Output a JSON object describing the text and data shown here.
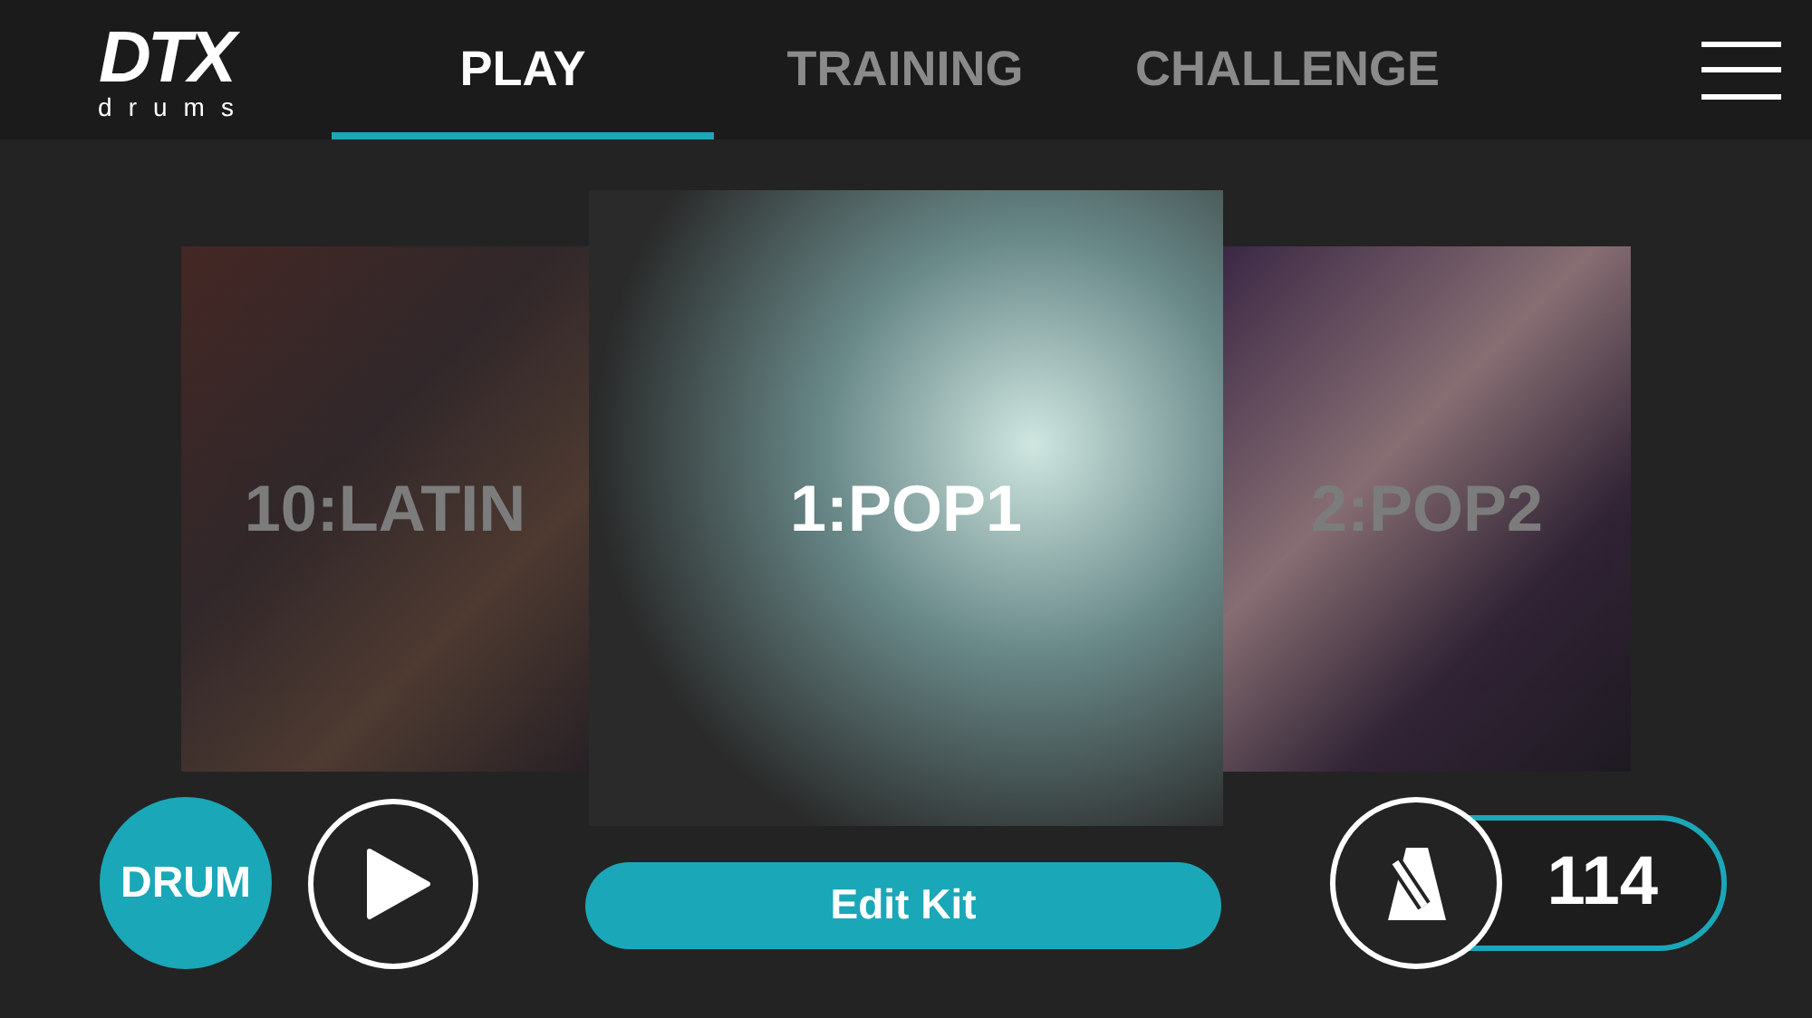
{
  "logo": {
    "mark": "DTX",
    "sub": "drums"
  },
  "tabs": [
    {
      "label": "PLAY",
      "selected": true
    },
    {
      "label": "TRAINING",
      "selected": false
    },
    {
      "label": "CHALLENGE",
      "selected": false
    }
  ],
  "kits": [
    {
      "label": "10:LATIN",
      "selected": false
    },
    {
      "label": "1:POP1",
      "selected": true
    },
    {
      "label": "2:POP2",
      "selected": false
    }
  ],
  "drum_button": "DRUM",
  "edit_button": "Edit Kit",
  "tempo": "114"
}
